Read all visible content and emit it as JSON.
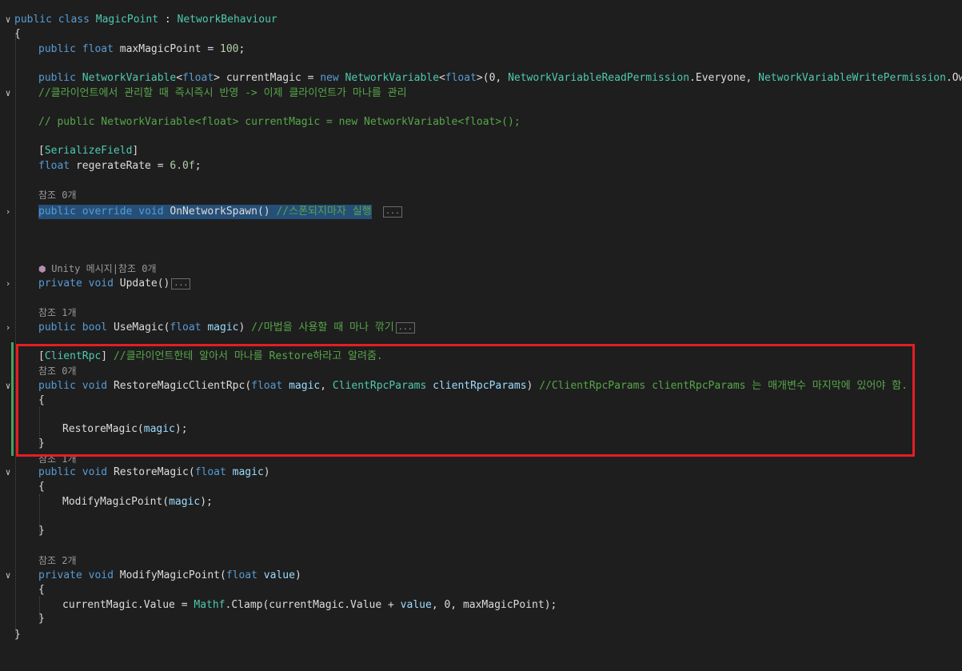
{
  "code": {
    "l1": {
      "a": "public class ",
      "b": "MagicPoint",
      "c": " : ",
      "d": "NetworkBehaviour"
    },
    "l2": {
      "a": "{"
    },
    "l3": {
      "a": "public ",
      "b": "float",
      "c": " maxMagicPoint = ",
      "d": "100",
      "e": ";"
    },
    "l4": {
      "a": "public ",
      "b": "NetworkVariable",
      "c": "<",
      "d": "float",
      "e": "> currentMagic = ",
      "f": "new ",
      "g": "NetworkVariable",
      "h": "<",
      "i": "float",
      "j": ">(0, ",
      "k": "NetworkVariableReadPermission",
      "l": ".Everyone, ",
      "m": "NetworkVariableWritePermission",
      "n": ".Owner);"
    },
    "l5": {
      "a": "//클라이언트에서 관리할 때 즉시즉시 반영 -> 이제 클라이언트가 마나를 관리"
    },
    "l6": {
      "a": "// public NetworkVariable<float> currentMagic = new NetworkVariable<float>();"
    },
    "l7": {
      "a": "[",
      "b": "SerializeField",
      "c": "]"
    },
    "l8": {
      "a": "float",
      "b": " regerateRate = ",
      "c": "6.0f",
      "d": ";"
    },
    "l9": {
      "a": "참조 0개"
    },
    "l10": {
      "a": "public ",
      "b": "override ",
      "c": "void ",
      "d": "OnNetworkSpawn",
      "e": "() ",
      "f": "//스폰되지마자 실행",
      "g": "..."
    },
    "l11": {
      "a": "Unity 메시지|참조 0개"
    },
    "l12": {
      "a": "private ",
      "b": "void ",
      "c": "Update",
      "d": "()",
      "e": "..."
    },
    "l13": {
      "a": "참조 1개"
    },
    "l14": {
      "a": "public ",
      "b": "bool ",
      "c": "UseMagic",
      "d": "(",
      "e": "float ",
      "f": "magic",
      "g": ") ",
      "h": "//마법을 사용할 때 마나 깎기",
      "i": "..."
    },
    "l15": {
      "a": "[",
      "b": "ClientRpc",
      "c": "] ",
      "d": "//클라이언트한테 알아서 마나를 Restore하라고 알려줌."
    },
    "l16": {
      "a": "참조 0개"
    },
    "l17": {
      "a": "public ",
      "b": "void ",
      "c": "RestoreMagicClientRpc",
      "d": "(",
      "e": "float ",
      "f": "magic",
      "g": ", ",
      "h": "ClientRpcParams",
      "i": " clientRpcParams",
      "j": ") ",
      "k": "//ClientRpcParams clientRpcParams 는 매개변수 마지막에 있어야 함."
    },
    "l18": {
      "a": "{"
    },
    "l19": {
      "a": "RestoreMagic",
      "b": "(",
      "c": "magic",
      "d": ");"
    },
    "l20": {
      "a": "}"
    },
    "l21": {
      "a": "참조 1개"
    },
    "l22": {
      "a": "public ",
      "b": "void ",
      "c": "RestoreMagic",
      "d": "(",
      "e": "float ",
      "f": "magic",
      "g": ")"
    },
    "l23": {
      "a": "{"
    },
    "l24": {
      "a": "ModifyMagicPoint",
      "b": "(",
      "c": "magic",
      "d": ");"
    },
    "l25": {
      "a": "}"
    },
    "l26": {
      "a": "참조 2개"
    },
    "l27": {
      "a": "private ",
      "b": "void ",
      "c": "ModifyMagicPoint",
      "d": "(",
      "e": "float ",
      "f": "value",
      "g": ")"
    },
    "l28": {
      "a": "{"
    },
    "l29": {
      "a": "currentMagic.Value = ",
      "b": "Mathf",
      "c": ".Clamp(currentMagic.Value + ",
      "d": "value",
      "e": ", 0, maxMagicPoint);"
    },
    "l30": {
      "a": "}"
    },
    "l31": {
      "a": "}"
    }
  },
  "gutter": {
    "expanded": "∨",
    "collapsed": "›"
  }
}
